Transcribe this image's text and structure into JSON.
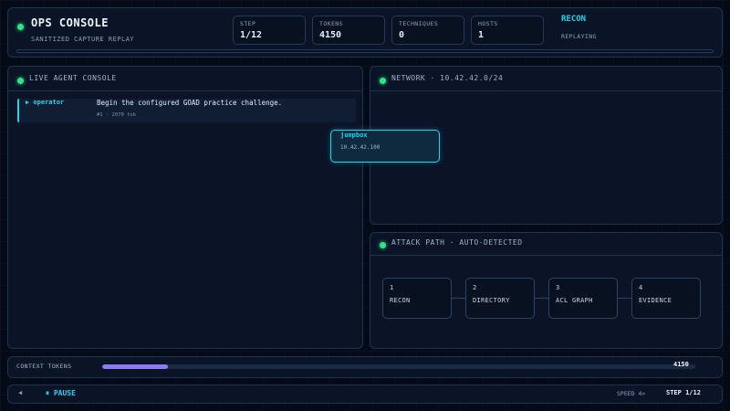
{
  "header": {
    "title": "OPS CONSOLE",
    "subtitle": "SANITIZED CAPTURE REPLAY",
    "phase": "RECON",
    "status": "REPLAYING",
    "stats": [
      {
        "label": "STEP",
        "value": "1/12"
      },
      {
        "label": "TOKENS",
        "value": "4150"
      },
      {
        "label": "TECHNIQUES",
        "value": "0"
      },
      {
        "label": "HOSTS",
        "value": "1"
      }
    ]
  },
  "console": {
    "title": "LIVE AGENT CONSOLE",
    "messages": [
      {
        "role": "▶ operator",
        "text": "Begin the configured GOAD practice challenge.",
        "meta": "#1 · 2070 tok"
      }
    ]
  },
  "network": {
    "title": "NETWORK · 10.42.42.0/24",
    "hosts": [
      {
        "name": "jumpbox",
        "ip": "10.42.42.100"
      }
    ]
  },
  "attack_path": {
    "title": "ATTACK PATH · AUTO-DETECTED",
    "steps": [
      {
        "num": "1",
        "label": "RECON"
      },
      {
        "num": "2",
        "label": "DIRECTORY"
      },
      {
        "num": "3",
        "label": "ACL GRAPH"
      },
      {
        "num": "4",
        "label": "EVIDENCE"
      }
    ]
  },
  "context": {
    "label": "CONTEXT TOKENS",
    "value": "4150",
    "fill_fraction": 0.11
  },
  "controls": {
    "prev_glyph": "◀",
    "pause_label": "⏸ PAUSE",
    "speed": "SPEED 4×",
    "step": "STEP 1/12"
  },
  "colors": {
    "accent": "#22d3ee",
    "ok": "#34e08a",
    "progress": "#8b7cf6"
  }
}
